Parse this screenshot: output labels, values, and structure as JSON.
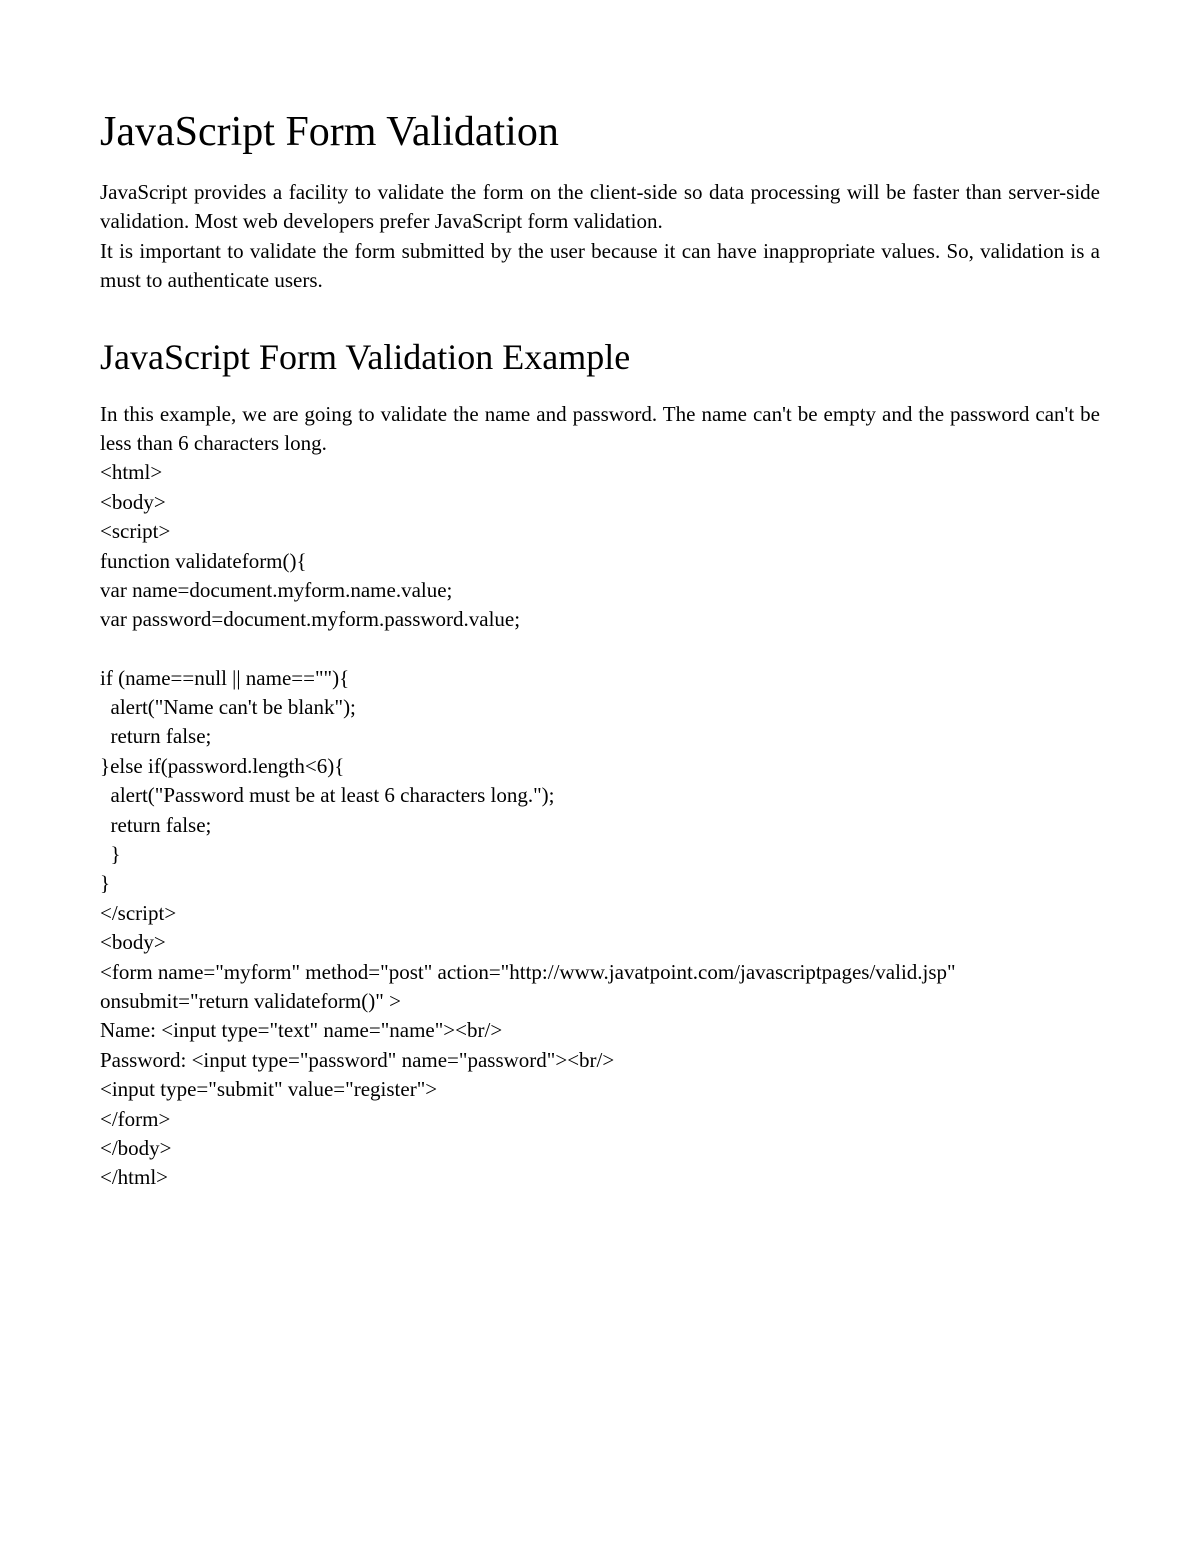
{
  "heading1": "JavaScript Form Validation",
  "intro_paragraph": "JavaScript provides a facility to validate the form on the client-side so data processing will be faster than server-side validation. Most web developers prefer JavaScript form validation.",
  "intro_paragraph2": "It is important to validate the form submitted by the user because it can have inappropriate values. So, validation is a must to authenticate users.",
  "heading2": "JavaScript Form Validation Example",
  "example_intro": "In this example, we are going to validate the name and password. The name can't be empty and the password can't be less than 6 characters long.",
  "code_lines": [
    "<html>",
    "<body>",
    "<script>",
    "function validateform(){",
    "var name=document.myform.name.value;",
    "var password=document.myform.password.value;",
    "",
    "if (name==null || name==\"\"){",
    "  alert(\"Name can't be blank\");",
    "  return false;",
    "}else if(password.length<6){",
    "  alert(\"Password must be at least 6 characters long.\");",
    "  return false;",
    "  }",
    "}",
    "</script>",
    "<body>",
    "<form name=\"myform\" method=\"post\" action=\"http://www.javatpoint.com/javascriptpages/valid.jsp\" onsubmit=\"return validateform()\" >",
    "Name: <input type=\"text\" name=\"name\"><br/>",
    "Password: <input type=\"password\" name=\"password\"><br/>",
    "<input type=\"submit\" value=\"register\">",
    "</form>",
    "</body>",
    "</html>"
  ]
}
